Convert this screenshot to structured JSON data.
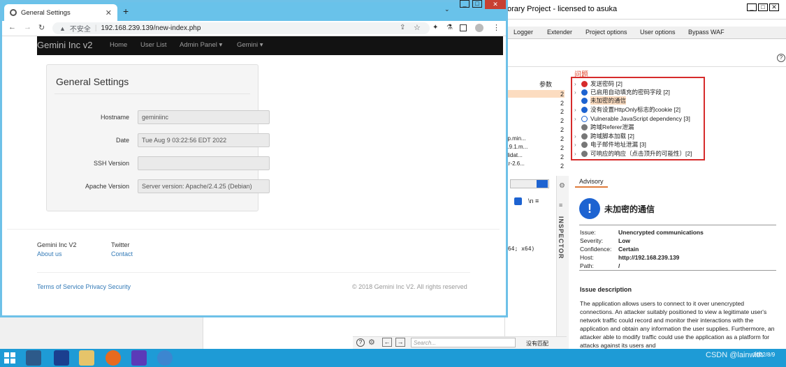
{
  "burp": {
    "title": "orary Project - licensed to asuka",
    "menu": [
      "Logger",
      "Extender",
      "Project options",
      "User options",
      "Bypass WAF"
    ],
    "issues_label": "问题",
    "table_header": "参数",
    "table_nums": [
      "2",
      "2",
      "2",
      "2",
      "2",
      "2",
      "2",
      "2",
      "2",
      "2"
    ],
    "table_frags": [
      "ap.min...",
      "1.9.1.m...",
      "alidat...",
      "izr-2.6..."
    ],
    "issues": [
      {
        "label": "发送密码 [2]",
        "icon": "red",
        "chevron": true
      },
      {
        "label": "已启用自动填充的密码字段 [2]",
        "icon": "blue",
        "chevron": true
      },
      {
        "label": "未加密的通信",
        "icon": "blue",
        "chevron": false,
        "highlight": true
      },
      {
        "label": "没有设置HttpOnly标志的cookie [2]",
        "icon": "blue",
        "chevron": true
      },
      {
        "label": "Vulnerable JavaScript dependency [3]",
        "icon": "hollow",
        "chevron": true
      },
      {
        "label": "跨域Referer泄漏",
        "icon": "gray",
        "chevron": false
      },
      {
        "label": "跨域脚本加载 [2]",
        "icon": "gray",
        "chevron": true
      },
      {
        "label": "电子邮件地址泄漏 [3]",
        "icon": "gray",
        "chevron": true
      },
      {
        "label": "可响应的响应（点击顶升的可能性）[2]",
        "icon": "gray",
        "chevron": true
      }
    ],
    "advisory_tab": "Advisory",
    "advisory_title": "未加密的通信",
    "advisory_fields": [
      {
        "k": "Issue:",
        "v": "Unencrypted communications"
      },
      {
        "k": "Severity:",
        "v": "Low"
      },
      {
        "k": "Confidence:",
        "v": "Certain"
      },
      {
        "k": "Host:",
        "v": "http://192.168.239.139"
      },
      {
        "k": "Path:",
        "v": "/"
      }
    ],
    "issue_description_heading": "Issue description",
    "issue_description": "The application allows users to connect to it over unencrypted connections. An attacker suitably positioned to view a legitimate user's network traffic could record and monitor their interactions with the application and obtain any information the user supplies. Furthermore, an attacker able to modify traffic could use the application as a platform for attacks against its users and",
    "inspector": "INSPECTOR",
    "search_placeholder": "Search...",
    "no_match": "没有匹配",
    "mid_text": "n64; x64)",
    "mid_icons": "\\n  ≡"
  },
  "chrome": {
    "tab_title": "General Settings",
    "url_insecure": "不安全",
    "url": "192.168.239.139/new-index.php"
  },
  "site": {
    "brand": "Gemini Inc v2",
    "nav": [
      "Home",
      "User List",
      "Admin Panel ▾",
      "Gemini ▾"
    ],
    "card_title": "General Settings",
    "fields": [
      {
        "label": "Hostname",
        "value": "geminiinc"
      },
      {
        "label": "Date",
        "value": "Tue Aug  9 03:22:56 EDT 2022"
      },
      {
        "label": "SSH Version",
        "value": ""
      },
      {
        "label": "Apache Version",
        "value": "Server version: Apache/2.4.25 (Debian)"
      }
    ],
    "footer_col1_title": "Gemini Inc V2",
    "footer_col1_link": "About us",
    "footer_col2_title": "Twitter",
    "footer_col2_link": "Contact",
    "footer_links": "Terms of Service Privacy Security",
    "copyright": "© 2018 Gemini Inc V2. All rights reserved"
  },
  "taskbar": {
    "watermark": "CSDN @lainwith",
    "date": "2022/8/9"
  }
}
